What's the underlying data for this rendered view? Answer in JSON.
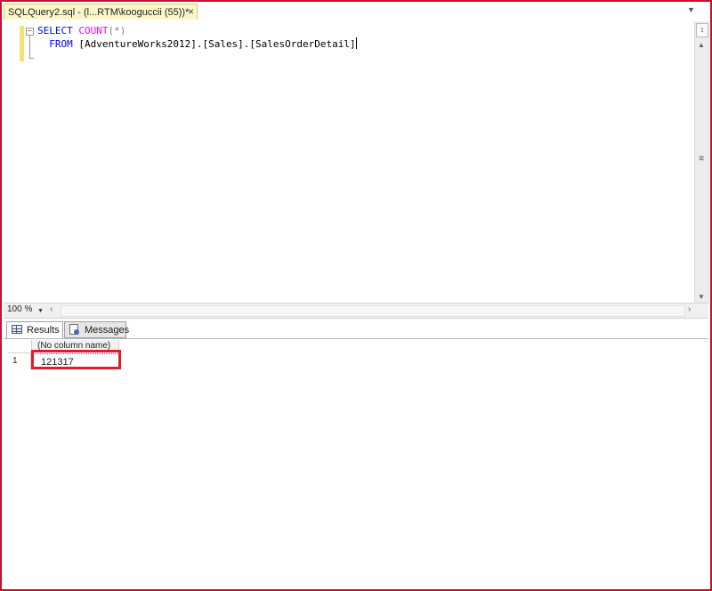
{
  "document_tab": {
    "title": "SQLQuery2.sql - (l...RTM\\kooguccii (55))*",
    "close_glyph": "×",
    "tab_color": "#fef6c9"
  },
  "editor": {
    "collapse_glyph": "−",
    "line1": {
      "keyword": "SELECT",
      "function": "COUNT",
      "args": "(*)"
    },
    "line2": {
      "keyword": "FROM",
      "object": "[AdventureWorks2012].[Sales].[SalesOrderDetail]"
    },
    "keyword_color": "#0000ff",
    "function_color": "#ff00ff"
  },
  "zoom": {
    "value": "100 %"
  },
  "results_tabs": [
    {
      "label": "Results",
      "icon": "grid-icon",
      "active": true
    },
    {
      "label": "Messages",
      "icon": "messages-icon",
      "active": false
    }
  ],
  "results_grid": {
    "columns": [
      "(No column name)"
    ],
    "rows": [
      {
        "row_number": "1",
        "values": [
          "121317"
        ]
      }
    ],
    "highlight_color": "#dd1e2f"
  }
}
